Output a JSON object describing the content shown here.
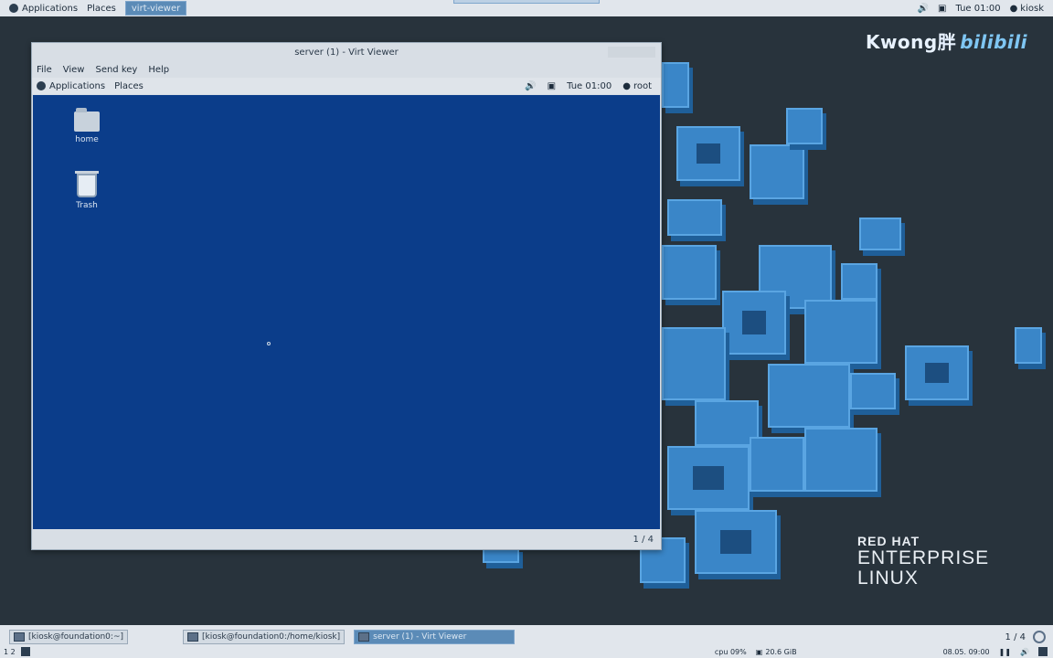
{
  "host_topbar": {
    "applications": "Applications",
    "places": "Places",
    "task_label": "virt-viewer",
    "clock": "Tue 01:00",
    "user": "kiosk"
  },
  "watermark": {
    "name": "Kwong胖",
    "brand": "bilibili"
  },
  "rhel": {
    "line1": "RED HAT",
    "line2": "ENTERPRISE",
    "line3": "LINUX"
  },
  "viewer": {
    "title": "server (1) - Virt Viewer",
    "menu": [
      "File",
      "View",
      "Send key",
      "Help"
    ],
    "guest_topbar": {
      "applications": "Applications",
      "places": "Places",
      "clock": "Tue 01:00",
      "user": "root"
    },
    "desktop_icons": [
      {
        "label": "home",
        "icon": "folder-icon"
      },
      {
        "label": "Trash",
        "icon": "trash-icon"
      }
    ],
    "page": "1 / 4"
  },
  "taskbar": {
    "windows": [
      {
        "label": "[kiosk@foundation0:~]",
        "active": false
      },
      {
        "label": "[kiosk@foundation0:/home/kiosk]",
        "active": false
      },
      {
        "label": "server (1) - Virt Viewer",
        "active": true
      }
    ],
    "page": "1 / 4",
    "workspaces": "1  2",
    "cpu": "cpu  09%",
    "disk": "20.6 GiB",
    "datetime": "08.05. 09:00"
  },
  "colors": {
    "accent": "#3a86c8",
    "guest_bg": "#0b3d8a",
    "panel": "#e1e6ec"
  }
}
